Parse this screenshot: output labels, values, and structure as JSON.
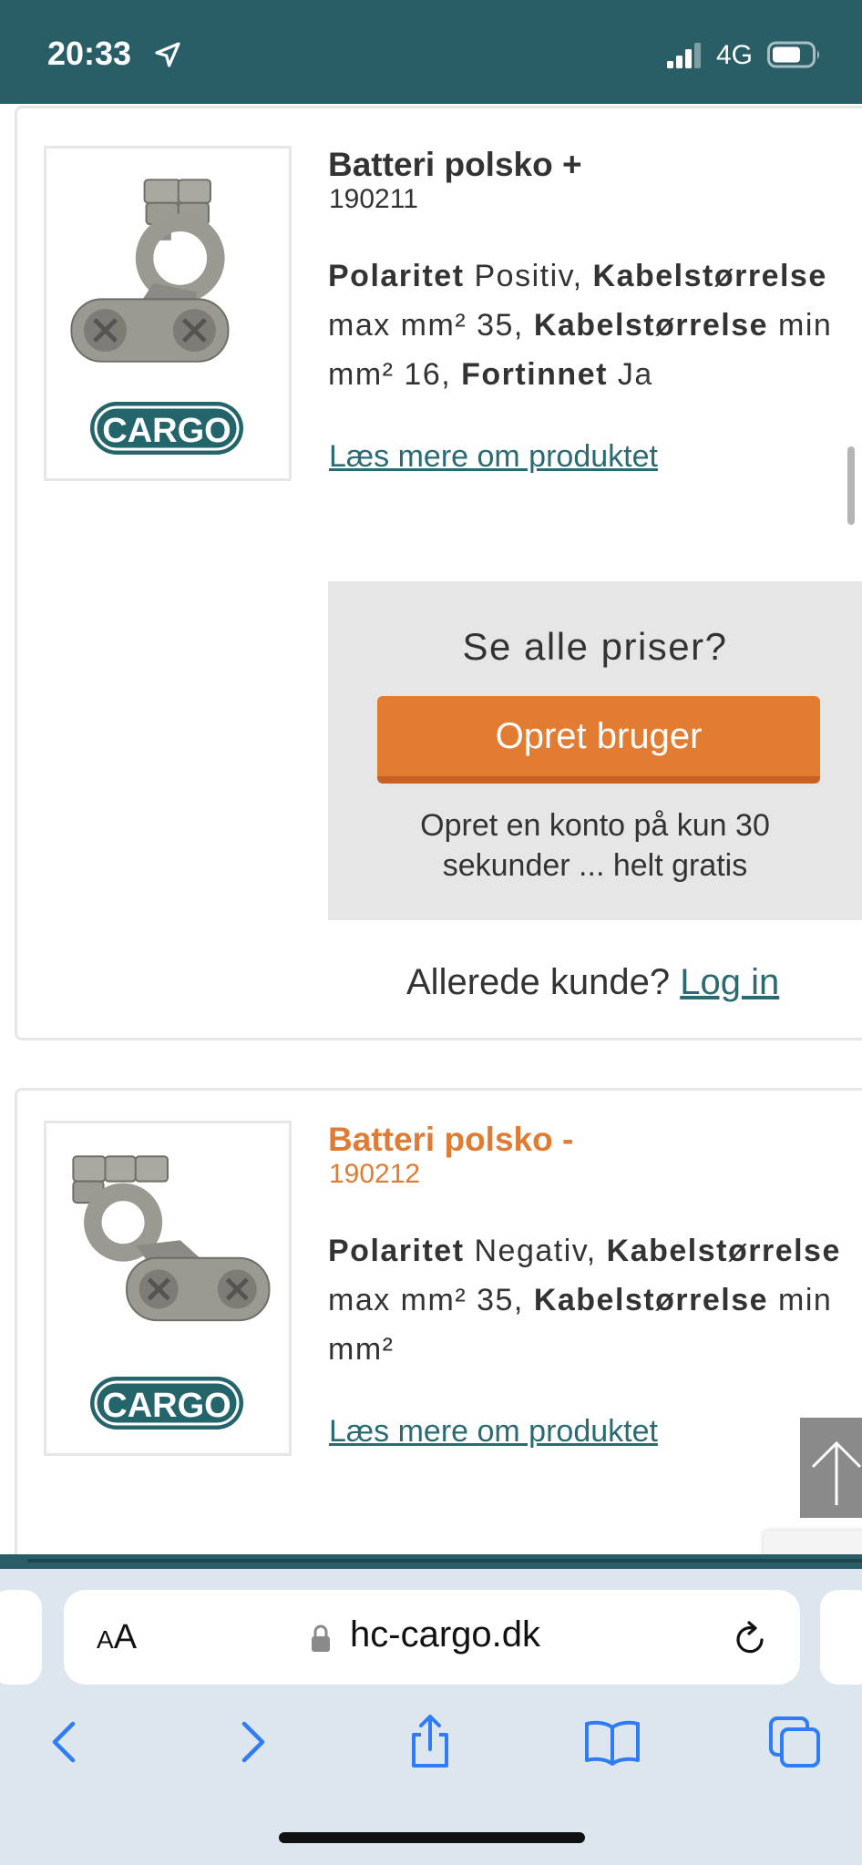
{
  "status_bar": {
    "time": "20:33",
    "network": "4G",
    "icons": [
      "location-arrow-icon",
      "signal-bars-icon",
      "battery-icon"
    ]
  },
  "products": [
    {
      "title": "Batteri polsko +",
      "sku": "190211",
      "desc_parts": [
        {
          "label": "Polaritet",
          "value": " Positiv, "
        },
        {
          "label": "Kabelstørrelse",
          "value": " max mm² 35, "
        },
        {
          "label": "Kabelstørrelse",
          "value": " min mm² 16, "
        },
        {
          "label": "Fortinnet",
          "value": " Ja"
        }
      ],
      "read_more": "Læs mere om produktet",
      "title_color": "#333333"
    },
    {
      "title": "Batteri polsko -",
      "sku": "190212",
      "desc_parts": [
        {
          "label": "Polaritet",
          "value": " Negativ, "
        },
        {
          "label": "Kabelstørrelse",
          "value": " max mm² 35, "
        },
        {
          "label": "Kabelstørrelse",
          "value": " min mm²"
        }
      ],
      "read_more": "Læs mere om produktet",
      "title_color": "#e07b34"
    }
  ],
  "logo_text": "CARGO",
  "price_box": {
    "heading": "Se alle priser?",
    "button": "Opret bruger",
    "note_line1": "Opret en konto på kun 30",
    "note_line2": "sekunder ... helt gratis"
  },
  "login": {
    "prompt": "Allerede kunde? ",
    "link": "Log in"
  },
  "browser": {
    "aa_small": "A",
    "aa_large": "A",
    "url": "hc-cargo.dk"
  },
  "colors": {
    "brand_teal": "#2a5e66",
    "link_teal": "#2a6b73",
    "accent_orange": "#e27c33"
  }
}
